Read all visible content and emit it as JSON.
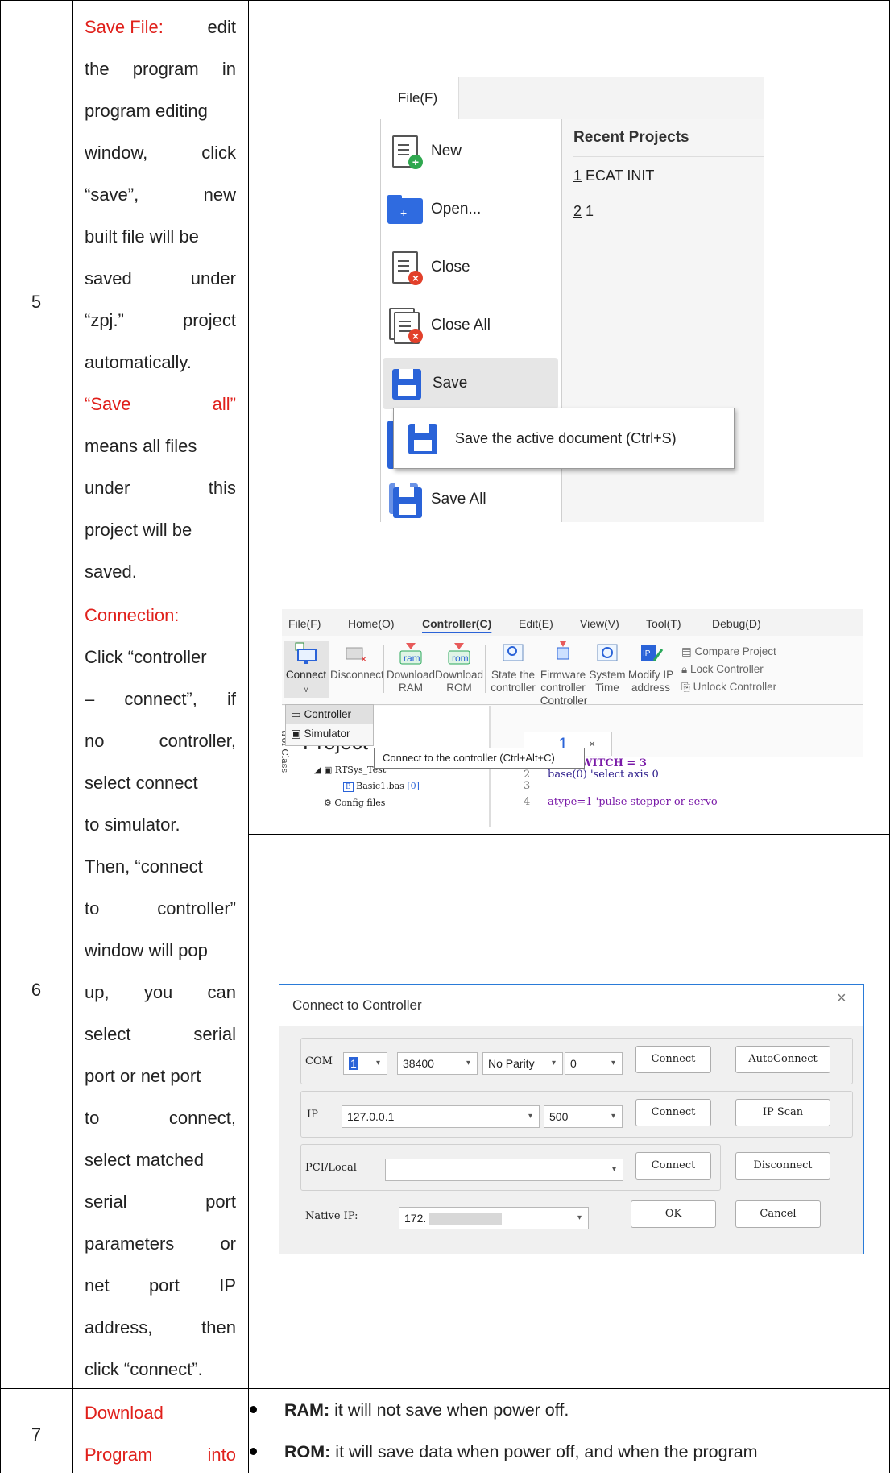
{
  "rows": [
    {
      "num": "5",
      "desc": [
        [
          {
            "t": "Save File:",
            "red": true
          },
          {
            "t": "edit"
          }
        ],
        [
          {
            "t": "the"
          },
          {
            "t": "program"
          },
          {
            "t": "in"
          }
        ],
        [
          {
            "t": "program editing"
          }
        ],
        [
          {
            "t": "window,"
          },
          {
            "t": "click"
          }
        ],
        [
          {
            "t": "“save”,"
          },
          {
            "t": "new"
          }
        ],
        [
          {
            "t": "built file will be"
          }
        ],
        [
          {
            "t": "saved"
          },
          {
            "t": "under"
          }
        ],
        [
          {
            "t": "“zpj.”"
          },
          {
            "t": "project"
          }
        ],
        [
          {
            "t": "automatically."
          }
        ],
        [
          {
            "t": "“Save",
            "red": true
          },
          {
            "t": "all”",
            "red": true
          }
        ],
        [
          {
            "t": "means all files"
          }
        ],
        [
          {
            "t": "under"
          },
          {
            "t": "this"
          }
        ],
        [
          {
            "t": "project will be"
          }
        ],
        [
          {
            "t": "saved."
          }
        ]
      ]
    },
    {
      "num": "6",
      "desc": [
        [
          {
            "t": "Connection:",
            "red": true
          }
        ],
        [
          {
            "t": "Click “controller"
          }
        ],
        [
          {
            "t": "–"
          },
          {
            "t": "connect”,"
          },
          {
            "t": "if"
          }
        ],
        [
          {
            "t": "no"
          },
          {
            "t": "controller,"
          }
        ],
        [
          {
            "t": "select connect"
          }
        ],
        [
          {
            "t": "to simulator."
          }
        ]
      ]
    },
    {
      "num": "",
      "desc": [
        [
          {
            "t": "Then, “connect"
          }
        ],
        [
          {
            "t": "to"
          },
          {
            "t": "controller”"
          }
        ],
        [
          {
            "t": "window will pop"
          }
        ],
        [
          {
            "t": "up,"
          },
          {
            "t": "you"
          },
          {
            "t": "can"
          }
        ],
        [
          {
            "t": "select"
          },
          {
            "t": "serial"
          }
        ],
        [
          {
            "t": "port or net port"
          }
        ],
        [
          {
            "t": "to"
          },
          {
            "t": "connect,"
          }
        ],
        [
          {
            "t": "select matched"
          }
        ],
        [
          {
            "t": "serial"
          },
          {
            "t": "port"
          }
        ],
        [
          {
            "t": "parameters"
          },
          {
            "t": "or"
          }
        ],
        [
          {
            "t": "net"
          },
          {
            "t": "port"
          },
          {
            "t": "IP"
          }
        ],
        [
          {
            "t": "address,"
          },
          {
            "t": "then"
          }
        ],
        [
          {
            "t": "click “connect”."
          }
        ]
      ]
    },
    {
      "num": "7",
      "desc": [
        [
          {
            "t": "Download",
            "red": true
          }
        ],
        [
          {
            "t": "Program",
            "red": true
          },
          {
            "t": "into",
            "red": true
          }
        ]
      ]
    }
  ],
  "bullets": [
    {
      "bold": "RAM:",
      "text": " it will not save when power off."
    },
    {
      "bold": "ROM:",
      "text": " it will save data when power off, and when the program"
    }
  ],
  "file_menu": {
    "tab": "File(F)",
    "items": [
      "New",
      "Open...",
      "Close",
      "Close All",
      "Save",
      "Save All"
    ],
    "recent_title": "Recent Projects",
    "recent": [
      {
        "k": "1",
        "name": " ECAT INIT"
      },
      {
        "k": "2",
        "name": " 1"
      }
    ],
    "tooltip": "Save the active document (Ctrl+S)"
  },
  "ribbon": {
    "tabs": [
      "File(F)",
      "Home(O)",
      "Controller(C)",
      "Edit(E)",
      "View(V)",
      "Tool(T)",
      "Debug(D)"
    ],
    "buttons": [
      {
        "l1": "Connect",
        "l2": "ᵥ"
      },
      {
        "l1": "Disconnect",
        "l2": ""
      },
      {
        "l1": "Download",
        "l2": "RAM"
      },
      {
        "l1": "Download",
        "l2": "ROM"
      },
      {
        "l1": "State the",
        "l2": "controller"
      },
      {
        "l1": "Firmware",
        "l2": "controller"
      },
      {
        "l1": "System",
        "l2": "Time"
      },
      {
        "l1": "Modify IP",
        "l2": "address"
      }
    ],
    "side": [
      "Compare Project",
      "Lock Controller",
      "Unlock Controller"
    ],
    "group": "Controller",
    "dropdown": [
      "Controller",
      "Simulator"
    ],
    "tooltip": "Connect to the controller (Ctrl+Alt+C)",
    "project_label": "Project",
    "tree": [
      "RTSys_Test",
      "Basic1.bas",
      "[0]",
      "Config files"
    ],
    "side_label": "trol Class",
    "tab_name": "1",
    "code": [
      {
        "n": "1",
        "c": "ERRSWITCH = 3"
      },
      {
        "n": "2",
        "c": "base(0) 'select axis 0"
      },
      {
        "n": "3",
        "c": ""
      },
      {
        "n": "4",
        "c": "atype=1  'pulse stepper or servo"
      }
    ]
  },
  "dialog": {
    "title": "Connect to Controller",
    "com_label": "COM",
    "com_port": "1",
    "baud": "38400",
    "parity": "No Parity",
    "stop": "0",
    "connect": "Connect",
    "autoconnect": "AutoConnect",
    "ip_label": "IP",
    "ip": "127.0.0.1",
    "ip_port": "500",
    "ip_scan": "IP Scan",
    "pci_label": "PCI/Local",
    "disconnect": "Disconnect",
    "native_label": "Native IP:",
    "native_ip": "172.",
    "ok": "OK",
    "cancel": "Cancel"
  }
}
